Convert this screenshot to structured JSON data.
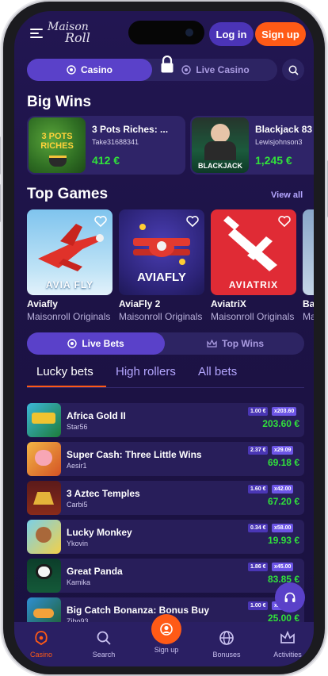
{
  "header": {
    "logo_line1": "Maison",
    "logo_line2": "Roll",
    "login_label": "Log in",
    "signup_label": "Sign up"
  },
  "categories": {
    "casino_label": "Casino",
    "live_casino_label": "Live Casino"
  },
  "big_wins": {
    "title": "Big Wins",
    "items": [
      {
        "game": "3 Pots Riches: ...",
        "user": "Take31688341",
        "amount": "412 €",
        "thumb_text": "3 POTS RICHES"
      },
      {
        "game": "Blackjack 83",
        "user": "Lewisjohnson3",
        "amount": "1,245 €",
        "thumb_text": "BLACKJACK"
      }
    ]
  },
  "top_games": {
    "title": "Top Games",
    "view_all": "View all",
    "items": [
      {
        "name": "Aviafly",
        "provider": "Maisonroll Originals",
        "thumb_text": "AVIA FLY"
      },
      {
        "name": "AviaFly 2",
        "provider": "Maisonroll Originals",
        "thumb_text": "AVIAFLY"
      },
      {
        "name": "AviatriX",
        "provider": "Maisonroll Originals",
        "thumb_text": "AVIATRIX"
      },
      {
        "name": "Ba",
        "provider": "Ma",
        "thumb_text": ""
      }
    ]
  },
  "bets_tabs": {
    "live_bets": "Live Bets",
    "top_wins": "Top Wins"
  },
  "sub_tabs": {
    "lucky": "Lucky bets",
    "high": "High rollers",
    "all": "All bets"
  },
  "bets": [
    {
      "game": "Africa Gold II",
      "user": "Star56",
      "bet": "1.00 €",
      "mult": "x203.60",
      "payout": "203.60 €"
    },
    {
      "game": "Super Cash: Three Little Wins",
      "user": "Aesir1",
      "bet": "2.37 €",
      "mult": "x29.09",
      "payout": "69.18 €"
    },
    {
      "game": "3 Aztec Temples",
      "user": "Carbi5",
      "bet": "1.60 €",
      "mult": "x42.00",
      "payout": "67.20 €"
    },
    {
      "game": "Lucky Monkey",
      "user": "Ykovin",
      "bet": "0.34 €",
      "mult": "x58.00",
      "payout": "19.93 €"
    },
    {
      "game": "Great Panda",
      "user": "Kamika",
      "bet": "1.86 €",
      "mult": "x45.00",
      "payout": "83.85 €"
    },
    {
      "game": "Big Catch Bonanza: Bonus Buy",
      "user": "Zibo93",
      "bet": "1.00 €",
      "mult": "x25.00",
      "payout": "25.00 €"
    }
  ],
  "bottom_nav": {
    "casino": "Casino",
    "search": "Search",
    "signup": "Sign up",
    "bonuses": "Bonuses",
    "activities": "Activities"
  },
  "colors": {
    "accent": "#ff5a16",
    "primary": "#5a41c9",
    "win_green": "#31e13b",
    "background": "#1d1346"
  }
}
